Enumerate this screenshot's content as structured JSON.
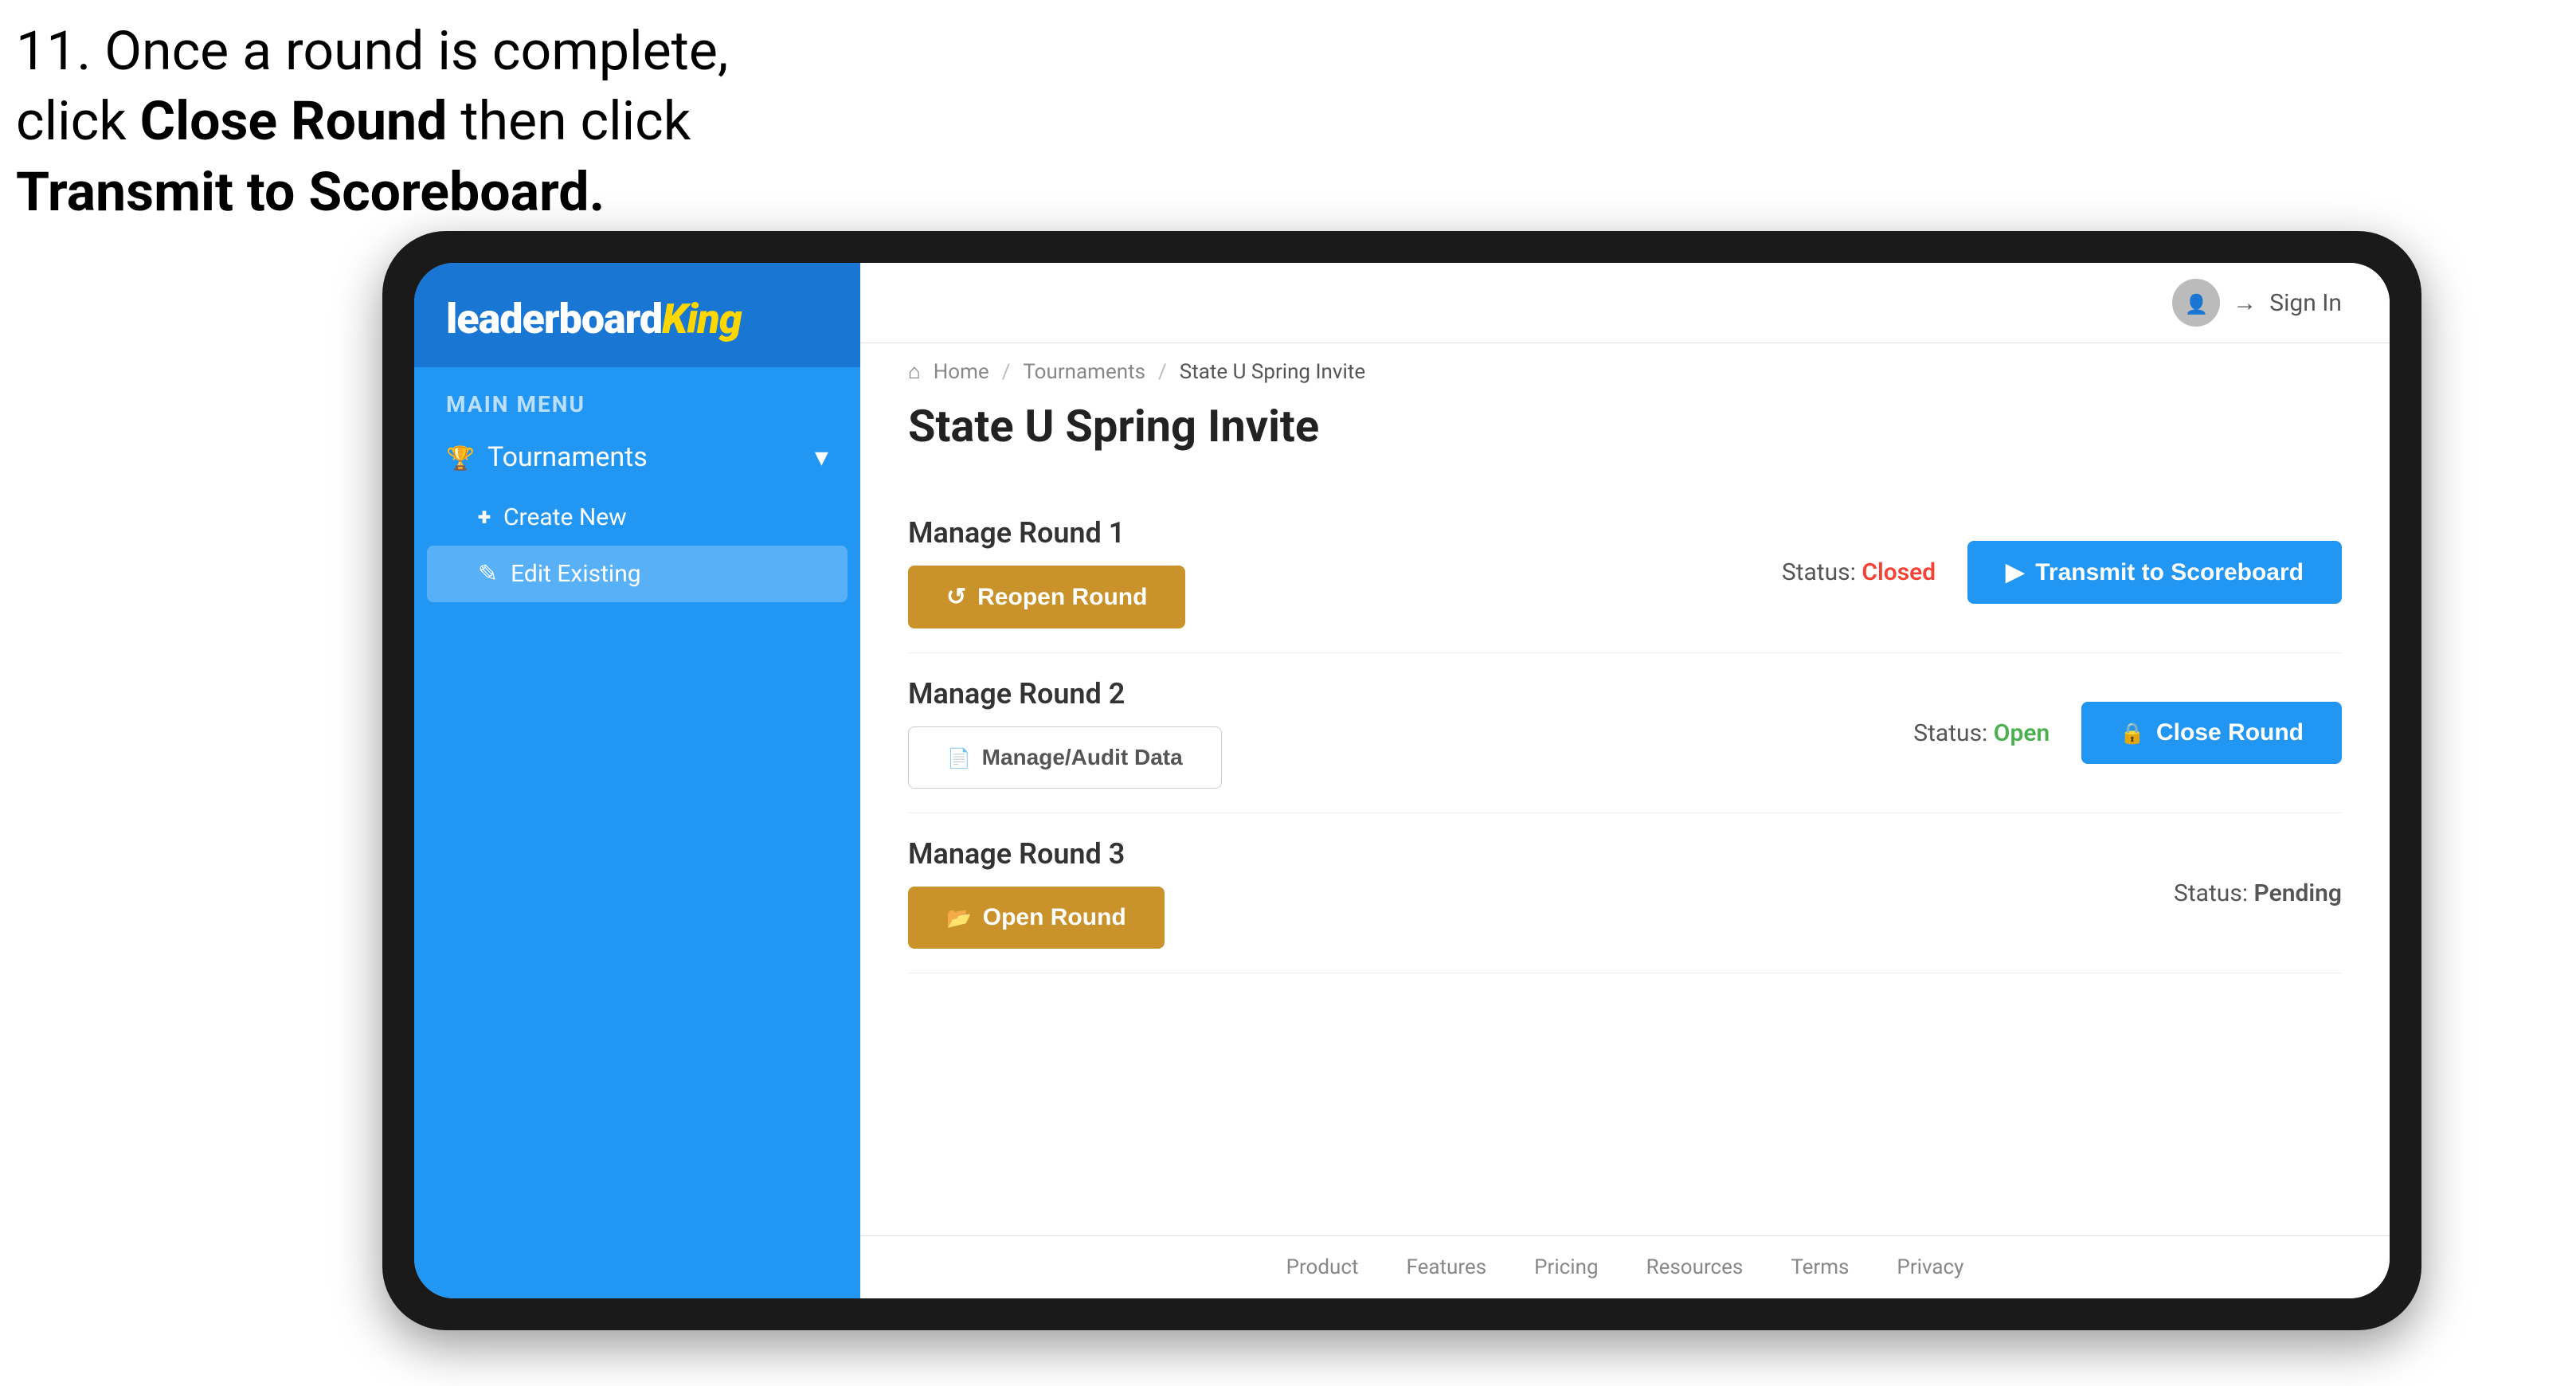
{
  "instruction": {
    "number": "11.",
    "line1": "Once a round is complete,",
    "line2_prefix": "click ",
    "bold1": "Close Round",
    "line2_suffix": " then click",
    "bold2": "Transmit to Scoreboard."
  },
  "header": {
    "sign_in_label": "Sign In"
  },
  "breadcrumb": {
    "home": "Home",
    "separator1": "/",
    "tournaments": "Tournaments",
    "separator2": "/",
    "current": "State U Spring Invite"
  },
  "page_title": "State U Spring Invite",
  "sidebar": {
    "logo": "leaderboard",
    "logo_king": "King",
    "menu_label": "MAIN MENU",
    "items": [
      {
        "label": "Tournaments",
        "icon": "trophy"
      }
    ],
    "subitems": [
      {
        "label": "Create New",
        "icon": "plus"
      },
      {
        "label": "Edit Existing",
        "icon": "edit",
        "active": true
      }
    ]
  },
  "rounds": [
    {
      "title": "Manage Round 1",
      "status_label": "Status:",
      "status_value": "Closed",
      "status_type": "closed",
      "left_button": {
        "label": "Reopen Round",
        "icon": "reopen",
        "style": "gold"
      },
      "right_button": {
        "label": "Transmit to Scoreboard",
        "icon": "transmit",
        "style": "blue"
      }
    },
    {
      "title": "Manage Round 2",
      "status_label": "Status:",
      "status_value": "Open",
      "status_type": "open",
      "left_button": {
        "label": "Manage/Audit Data",
        "icon": "doc",
        "style": "outline"
      },
      "right_button": {
        "label": "Close Round",
        "icon": "close",
        "style": "blue"
      }
    },
    {
      "title": "Manage Round 3",
      "status_label": "Status:",
      "status_value": "Pending",
      "status_type": "pending",
      "left_button": {
        "label": "Open Round",
        "icon": "open",
        "style": "gold"
      },
      "right_button": null
    }
  ],
  "footer": {
    "links": [
      "Product",
      "Features",
      "Pricing",
      "Resources",
      "Terms",
      "Privacy"
    ]
  }
}
